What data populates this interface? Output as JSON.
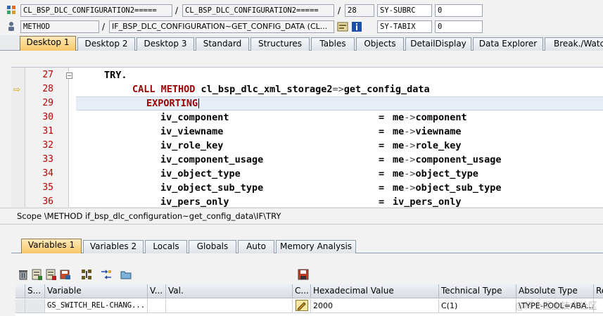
{
  "top": {
    "row1": {
      "program": "CL_BSP_DLC_CONFIGURATION2=====",
      "include": "CL_BSP_DLC_CONFIGURATION2=====",
      "line": "28",
      "sysfield_name": "SY-SUBRC",
      "sysfield_value": "0"
    },
    "row2": {
      "event_type": "METHOD",
      "event": "IF_BSP_DLC_CONFIGURATION~GET_CONFIG_DATA (CL...",
      "sysfield_name": "SY-TABIX",
      "sysfield_value": "0"
    },
    "separator": "/"
  },
  "desktop_tabs": [
    "Desktop 1",
    "Desktop 2",
    "Desktop 3",
    "Standard",
    "Structures",
    "Tables",
    "Objects",
    "DetailDisplay",
    "Data Explorer",
    "Break./Watch"
  ],
  "code": {
    "lines": [
      {
        "num": "27"
      },
      {
        "num": "28"
      },
      {
        "num": "29"
      },
      {
        "num": "30",
        "param": "iv_component",
        "eq": "=",
        "me": "me",
        "arrow": "->",
        "target": "component"
      },
      {
        "num": "31",
        "param": "iv_viewname",
        "eq": "=",
        "me": "me",
        "arrow": "->",
        "target": "viewname"
      },
      {
        "num": "32",
        "param": "iv_role_key",
        "eq": "=",
        "me": "me",
        "arrow": "->",
        "target": "role_key"
      },
      {
        "num": "33",
        "param": "iv_component_usage",
        "eq": "=",
        "me": "me",
        "arrow": "->",
        "target": "component_usage"
      },
      {
        "num": "34",
        "param": "iv_object_type",
        "eq": "=",
        "me": "me",
        "arrow": "->",
        "target": "object_type"
      },
      {
        "num": "35",
        "param": "iv_object_sub_type",
        "eq": "=",
        "me": "me",
        "arrow": "->",
        "target": "object_sub_type"
      },
      {
        "num": "36",
        "param": "iv_pers_only",
        "eq": "=",
        "value": "iv_pers_only"
      }
    ],
    "try_kw": "TRY.",
    "call_kw": "CALL METHOD",
    "call_target": "cl_bsp_dlc_xml_storage2",
    "call_arrow": "=>",
    "call_method": "get_config_data",
    "exporting_kw": "EXPORTING"
  },
  "scope": "Scope \\METHOD if_bsp_dlc_configuration~get_config_data\\IF\\TRY",
  "variable_tabs": [
    "Variables 1",
    "Variables 2",
    "Locals",
    "Globals",
    "Auto",
    "Memory Analysis"
  ],
  "grid": {
    "headers": [
      "S...",
      "Variable",
      "V...",
      "Val.",
      "C...",
      "Hexadecimal Value",
      "Technical Type",
      "Absolute Type",
      "Re"
    ],
    "row": {
      "variable": "GS_SWITCH_REL-CHANG...",
      "hex": "2000",
      "technical_type": "C(1)",
      "absolute_type": "\\TYPE-POOL=ABA..."
    }
  },
  "watermark": "@稀土掘金技术社区",
  "colors": {
    "keyword": "#9b0000",
    "line_number": "#c00000",
    "active_tab": "#f7c86a"
  }
}
